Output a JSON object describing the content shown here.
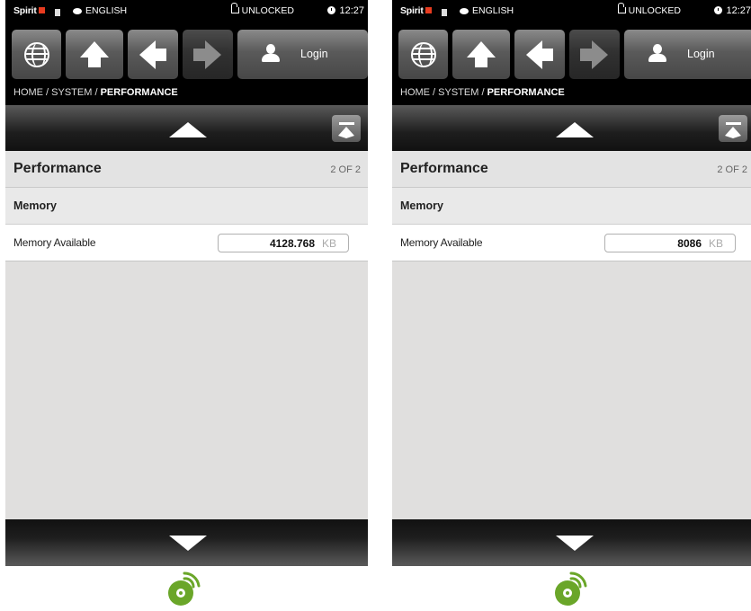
{
  "panels": [
    {
      "statusbar": {
        "brand": "Spirit",
        "language": "ENGLISH",
        "lock_status": "UNLOCKED",
        "time": "12:27"
      },
      "nav": {
        "login_label": "Login",
        "icons": [
          "globe-icon",
          "up-arrow-icon",
          "back-arrow-icon",
          "forward-arrow-icon",
          "user-icon"
        ]
      },
      "breadcrumb": {
        "path": "HOME / SYSTEM / ",
        "current": "PERFORMANCE"
      },
      "page": {
        "title": "Performance",
        "count": "2 OF 2"
      },
      "section": {
        "title": "Memory"
      },
      "rows": [
        {
          "label": "Memory Available",
          "value": "4128.768",
          "unit": "KB"
        }
      ]
    },
    {
      "statusbar": {
        "brand": "Spirit",
        "language": "ENGLISH",
        "lock_status": "UNLOCKED",
        "time": "12:27"
      },
      "nav": {
        "login_label": "Login",
        "icons": [
          "globe-icon",
          "up-arrow-icon",
          "back-arrow-icon",
          "forward-arrow-icon",
          "user-icon"
        ]
      },
      "breadcrumb": {
        "path": "HOME / SYSTEM / ",
        "current": "PERFORMANCE"
      },
      "page": {
        "title": "Performance",
        "count": "2 OF 2"
      },
      "section": {
        "title": "Memory"
      },
      "rows": [
        {
          "label": "Memory Available",
          "value": "8086",
          "unit": "KB"
        }
      ]
    }
  ],
  "colors": {
    "brand_red": "#e83b1f",
    "logo_green": "#6aa629",
    "content_bg": "#e0dfde"
  }
}
